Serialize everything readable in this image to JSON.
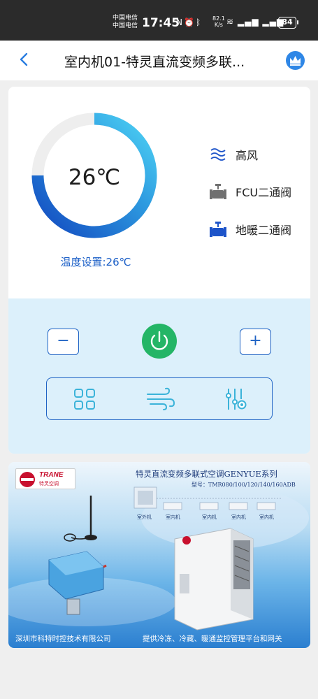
{
  "status_bar": {
    "carrier_1": "中国电信",
    "carrier_2": "中国电信",
    "time": "17:45",
    "net_speed_value": "82.1",
    "net_speed_unit": "K/s",
    "battery": "84"
  },
  "header": {
    "title": "室内机01-特灵直流变频多联...",
    "back_icon": "chevron-left-icon",
    "vip_icon": "crown-icon"
  },
  "device": {
    "current_temp": "26℃",
    "temp_setting": "温度设置:26℃",
    "gauge_level": 0.75,
    "statuses": [
      {
        "label": "高风",
        "icon": "wind-icon"
      },
      {
        "label": "FCU二通阀",
        "icon": "valve-icon"
      },
      {
        "label": "地暖二通阀",
        "icon": "valve-icon"
      }
    ],
    "colors": {
      "accent": "#1f63c4",
      "power": "#24b566",
      "gauge_start": "#1249c0",
      "gauge_end": "#4fd4f5",
      "valve_off": "#707070",
      "valve_on": "#1d54c9"
    }
  },
  "controls": {
    "minus_label": "−",
    "plus_label": "+",
    "power_icon": "power-icon",
    "mode_icons": [
      "grid-icon",
      "fan-speed-icon",
      "settings-sliders-icon"
    ]
  },
  "banner": {
    "brand": "TRANE",
    "brand_sub": "特灵空调",
    "title": "特灵直流变频多联式空调GENYUE系列",
    "model": "型号：TMR080/100/120/140/160ADB",
    "unit_labels": [
      "室外机",
      "室内机",
      "室内机",
      "室内机",
      "室内机"
    ],
    "footer_left": "深圳市科特时控技术有限公司",
    "footer_right": "提供冷冻、冷藏、暖通监控管理平台和网关"
  }
}
